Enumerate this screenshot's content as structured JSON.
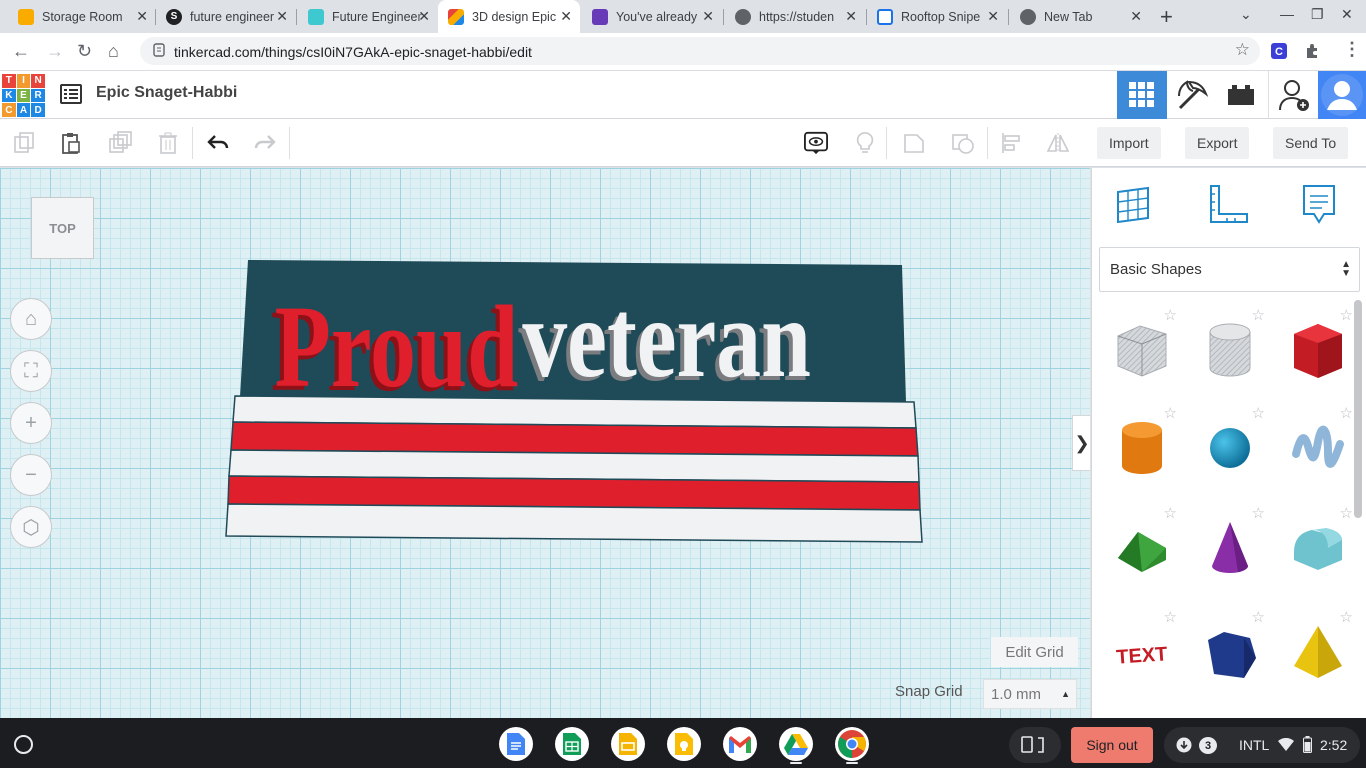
{
  "browser": {
    "tabs": [
      {
        "title": "Storage Room",
        "fav_color": "#f9ab00",
        "fav_glyph": ""
      },
      {
        "title": "future engineer",
        "fav_color": "#202124",
        "fav_glyph": "S"
      },
      {
        "title": "Future Engineer",
        "fav_color": "#3ec8cf",
        "fav_glyph": ""
      },
      {
        "title": "3D design Epic",
        "fav_color": "#e8443b",
        "fav_glyph": "",
        "active": true
      },
      {
        "title": "You've already",
        "fav_color": "#673ab7",
        "fav_glyph": ""
      },
      {
        "title": "https://studen",
        "fav_color": "#5f6368",
        "fav_glyph": ""
      },
      {
        "title": "Rooftop Snipe",
        "fav_color": "#1a73e8",
        "fav_glyph": ""
      },
      {
        "title": "New Tab",
        "fav_color": "#5f6368",
        "fav_glyph": ""
      }
    ],
    "url": "tinkercad.com/things/csI0iN7GAkA-epic-snaget-habbi/edit"
  },
  "app": {
    "logo_letters": [
      "T",
      "I",
      "N",
      "K",
      "E",
      "R",
      "C",
      "A",
      "D"
    ],
    "design_title": "Epic Snaget-Habbi",
    "header_icons": [
      "3d-view-grid-icon",
      "pickaxe-icon",
      "bricks-icon",
      "add-user-icon",
      "user-avatar-icon"
    ]
  },
  "edit_toolbar": {
    "import_label": "Import",
    "export_label": "Export",
    "send_to_label": "Send To"
  },
  "workplane": {
    "viewcube_label": "TOP",
    "model_text_red": "Proud",
    "model_text_white": "veteran",
    "edit_grid_label": "Edit Grid",
    "snap_grid_label": "Snap Grid",
    "snap_grid_value": "1.0 mm",
    "colors": {
      "red": "#e01f2d",
      "navy": "#1f4a58",
      "white": "#f1f2f3"
    }
  },
  "shapes_panel": {
    "category": "Basic Shapes",
    "shapes": [
      "box-hole",
      "cylinder-hole",
      "box",
      "cylinder",
      "sphere",
      "scribble",
      "roof",
      "cone",
      "round-roof",
      "text",
      "polygon",
      "pyramid"
    ]
  },
  "shelf": {
    "apps": [
      "google-docs",
      "google-sheets",
      "google-slides",
      "google-keep",
      "gmail",
      "google-drive",
      "chrome"
    ],
    "signout_label": "Sign out",
    "notification_count": "3",
    "input_method": "INTL",
    "time": "2:52"
  }
}
